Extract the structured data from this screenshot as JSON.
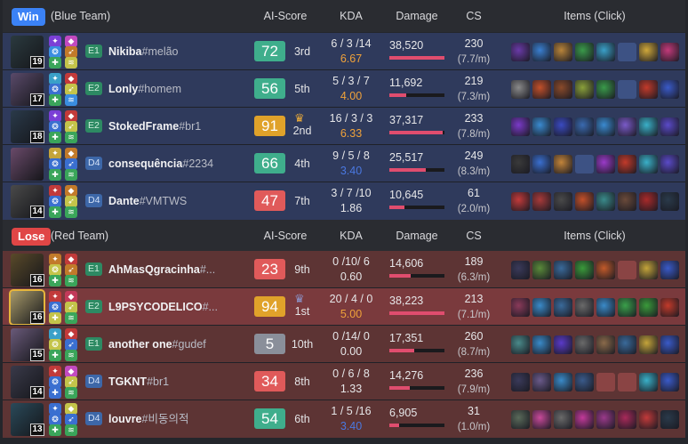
{
  "columns": {
    "ai_score": "AI-Score",
    "kda": "KDA",
    "damage": "Damage",
    "cs": "CS",
    "items": "Items (Click)"
  },
  "blue_team": {
    "result": "Win",
    "name": "(Blue Team)",
    "result_color": "#3b82f6",
    "players": [
      {
        "level": "19",
        "rank": "E1",
        "name": "Nikiba",
        "tag": "#melão",
        "score": "72",
        "place": "3rd",
        "kda": "6 / 3 /14",
        "ratio": "6.67",
        "ratio_color": "#f0a23a",
        "damage": "38,520",
        "damage_frac": 1.0,
        "cs": "230",
        "cs_pm": "(7.7/m)",
        "champ_color": "#2b3a3f",
        "spells": [
          "#7b3fd6",
          "#c24ac0",
          "#3a8de0",
          "#c27a2a",
          "#3aa55a",
          "#c4c44a"
        ],
        "items": [
          "#6a3aa8",
          "#3a7fd0",
          "#b8843a",
          "#3a9a4a",
          "#3aa0c8",
          "",
          "#d0a83a",
          "#c23a7a"
        ]
      },
      {
        "level": "17",
        "rank": "E2",
        "name": "Lonly",
        "tag": "#homem",
        "score": "56",
        "place": "5th",
        "kda": "5 / 3 / 7",
        "ratio": "4.00",
        "ratio_color": "#f0a23a",
        "damage": "11,692",
        "damage_frac": 0.3,
        "cs": "219",
        "cs_pm": "(7.3/m)",
        "champ_color": "#5a4a6a",
        "spells": [
          "#3aa0c8",
          "#c23a3a",
          "#3a6fd0",
          "#c4c44a",
          "#3aa55a",
          "#3a8de0"
        ],
        "items": [
          "#8a8a8a",
          "#c2502a",
          "#8a4a2a",
          "#8aa03a",
          "#3a9a4a",
          "",
          "#c23a2a",
          "#3a5ac8"
        ]
      },
      {
        "level": "18",
        "rank": "E2",
        "name": "StokedFrame",
        "tag": "#br1",
        "score": "91",
        "place": "2nd",
        "kda": "16 / 3 / 3",
        "ratio": "6.33",
        "ratio_color": "#f0a23a",
        "damage": "37,317",
        "damage_frac": 0.97,
        "cs": "233",
        "cs_pm": "(7.8/m)",
        "champ_color": "#2a3a4a",
        "crown": true,
        "spells": [
          "#7b3fd6",
          "#c23a3a",
          "#3a6fd0",
          "#c4c44a",
          "#3aa55a",
          "#3aa55a"
        ],
        "items": [
          "#7a3ac8",
          "#3a8ad0",
          "#3a4ac0",
          "#3a6ab0",
          "#3a8ad0",
          "#7a5ac8",
          "#3ab0c8",
          "#5a4ac8"
        ]
      },
      {
        "level": "",
        "rank": "D4",
        "name": "consequência",
        "tag": "#2234",
        "score": "66",
        "place": "4th",
        "kda": "9 / 5 / 8",
        "ratio": "3.40",
        "ratio_color": "#4a78e0",
        "damage": "25,517",
        "damage_frac": 0.66,
        "cs": "249",
        "cs_pm": "(8.3/m)",
        "champ_color": "#6a4a6a",
        "spells": [
          "#c4a43a",
          "#c27a2a",
          "#3a6fd0",
          "#3a6fd0",
          "#3aa55a",
          "#3aa55a"
        ],
        "items": [
          "#3a3a3a",
          "#3a6fd0",
          "#c2843a",
          "",
          "#9a3ac8",
          "#c23a2a",
          "#3ab0c8",
          "#5a4ac8"
        ]
      },
      {
        "level": "14",
        "rank": "D4",
        "name": "Dante",
        "tag": "#VMTWS",
        "score": "47",
        "place": "7th",
        "kda": "3 / 7 /10",
        "ratio": "1.86",
        "ratio_color": "#e6e6e8",
        "damage": "10,645",
        "damage_frac": 0.28,
        "cs": "61",
        "cs_pm": "(2.0/m)",
        "champ_color": "#4a4a4a",
        "spells": [
          "#c23a3a",
          "#c27a2a",
          "#3a6fd0",
          "#c4c44a",
          "#3aa55a",
          "#3aa55a"
        ],
        "items": [
          "#c23a3a",
          "#a83a3a",
          "#4a4a4a",
          "#c2502a",
          "#3a8a8a",
          "#6a4a3a",
          "#a82a2a",
          "#2a3a4a"
        ]
      }
    ]
  },
  "red_team": {
    "result": "Lose",
    "name": "(Red Team)",
    "result_color": "#e04646",
    "players": [
      {
        "level": "16",
        "rank": "E1",
        "name": "AhMasQgracinha",
        "tag": "#...",
        "score": "23",
        "place": "9th",
        "kda": "0 /10/ 6",
        "ratio": "0.60",
        "ratio_color": "#e6e6e8",
        "damage": "14,606",
        "damage_frac": 0.38,
        "cs": "189",
        "cs_pm": "(6.3/m)",
        "champ_color": "#5a4a2a",
        "spells": [
          "#c27a2a",
          "#c23a3a",
          "#c4c44a",
          "#c27a2a",
          "#3aa55a",
          "#3aa55a"
        ],
        "items": [
          "#3a3a5a",
          "#5a8a3a",
          "#3a6a9a",
          "#3a9a3a",
          "#c25a2a",
          "",
          "#c4a43a",
          "#3a5ac8"
        ]
      },
      {
        "level": "16",
        "rank": "E2",
        "name": "L9PSYCODELICO",
        "tag": "#...",
        "score": "94",
        "place": "1st",
        "kda": "20 / 4 / 0",
        "ratio": "5.00",
        "ratio_color": "#f0a23a",
        "damage": "38,223",
        "damage_frac": 1.0,
        "cs": "213",
        "cs_pm": "(7.1/m)",
        "champ_color": "#a89a6a",
        "crown": true,
        "gold": true,
        "spells": [
          "#c23a3a",
          "#c23a5a",
          "#3a6fd0",
          "#c4c44a",
          "#c4c44a",
          "#3aa55a"
        ],
        "items": [
          "#8a3a5a",
          "#3a8ac8",
          "#3a6a9a",
          "#6a6a6a",
          "#3a8ac8",
          "#3aa04a",
          "#3a9a3a",
          "#c23a2a"
        ]
      },
      {
        "level": "15",
        "rank": "E1",
        "name": "another one",
        "tag": "#gudef",
        "score": "5",
        "place": "10th",
        "kda": "0 /14/ 0",
        "ratio": "0.00",
        "ratio_color": "#e6e6e8",
        "damage": "17,351",
        "damage_frac": 0.45,
        "cs": "260",
        "cs_pm": "(8.7/m)",
        "champ_color": "#6a5a7a",
        "spells": [
          "#3aa0c8",
          "#c23a3a",
          "#c4c44a",
          "#3a6fd0",
          "#3aa55a",
          "#3aa55a"
        ],
        "items": [
          "#4a8a8a",
          "#3a8ac8",
          "#5a3ac8",
          "#6a6a6a",
          "#8a6a4a",
          "#3a6a9a",
          "#c4a43a",
          "#3a5ac8"
        ]
      },
      {
        "level": "14",
        "rank": "D4",
        "name": "TGKNT",
        "tag": "#br1",
        "score": "34",
        "place": "8th",
        "kda": "0 / 6 / 8",
        "ratio": "1.33",
        "ratio_color": "#e6e6e8",
        "damage": "14,276",
        "damage_frac": 0.37,
        "cs": "236",
        "cs_pm": "(7.9/m)",
        "champ_color": "#3a3a4a",
        "spells": [
          "#c23a3a",
          "#c24ac0",
          "#3a6fd0",
          "#c4c44a",
          "#3a6fd0",
          "#3aa55a"
        ],
        "items": [
          "#3a3a5a",
          "#6a5a8a",
          "#3a8ac8",
          "#3a5a8a",
          "",
          "",
          "#3ab0c8",
          "#3a5ac8"
        ]
      },
      {
        "level": "13",
        "rank": "D4",
        "name": "louvre",
        "tag": "#비동의적",
        "score": "54",
        "place": "6th",
        "kda": "1 / 5 /16",
        "ratio": "3.40",
        "ratio_color": "#4a78e0",
        "damage": "6,905",
        "damage_frac": 0.18,
        "cs": "31",
        "cs_pm": "(1.0/m)",
        "champ_color": "#2a4a5a",
        "spells": [
          "#3a6fd0",
          "#c4c44a",
          "#3a6fd0",
          "#3a6fd0",
          "#3aa55a",
          "#3aa55a"
        ],
        "items": [
          "#5a6a5a",
          "#c84a9a",
          "#6a6a6a",
          "#c23a9a",
          "#9a3a8a",
          "#a82a5a",
          "#c23a3a",
          "#2a3a4a"
        ]
      }
    ]
  },
  "score_colors": {
    "high": "#e0a22a",
    "mid": "#3fae8c",
    "low": "#e05a5a",
    "lowest": "#8a8f9a"
  }
}
